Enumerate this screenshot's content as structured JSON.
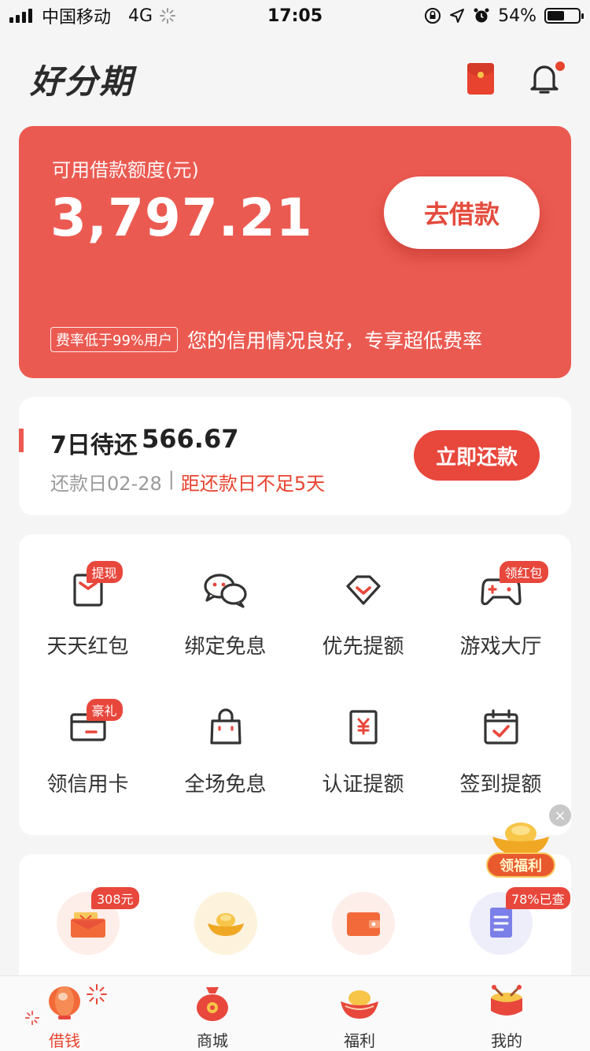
{
  "status_bar": {
    "carrier": "中国移动",
    "network": "4G",
    "time": "17:05",
    "battery": "54%",
    "battery_level": 0.54
  },
  "header": {
    "logo": "好分期",
    "icons": [
      "red-envelope-icon",
      "bell-icon"
    ]
  },
  "credit": {
    "label": "可用借款额度(元)",
    "amount": "3,797.21",
    "borrow_button": "去借款",
    "tag": "费率低于99%用户",
    "note": "您的信用情况良好，专享超低费率"
  },
  "repay": {
    "title": "7日待还",
    "amount": "566.67",
    "due_date": "还款日02-28",
    "separator": "|",
    "warning": "距还款日不足5天",
    "button": "立即还款"
  },
  "grid": [
    {
      "label": "天天红包",
      "badge": "提现",
      "icon": "red-envelope-icon"
    },
    {
      "label": "绑定免息",
      "badge": "",
      "icon": "wechat-icon"
    },
    {
      "label": "优先提额",
      "badge": "",
      "icon": "diamond-icon"
    },
    {
      "label": "游戏大厅",
      "badge": "领红包",
      "icon": "gamepad-icon"
    },
    {
      "label": "领信用卡",
      "badge": "豪礼",
      "icon": "credit-card-icon"
    },
    {
      "label": "全场免息",
      "badge": "",
      "icon": "shopping-bag-icon"
    },
    {
      "label": "认证提额",
      "badge": "",
      "icon": "certificate-icon"
    },
    {
      "label": "签到提额",
      "badge": "",
      "icon": "calendar-check-icon"
    }
  ],
  "services": [
    {
      "badge": "308元",
      "icon": "red-envelope-icon"
    },
    {
      "badge": "",
      "icon": "gold-ingot-icon"
    },
    {
      "badge": "",
      "icon": "wallet-icon"
    },
    {
      "badge": "78%已查",
      "icon": "document-icon"
    }
  ],
  "floating": {
    "label": "领福利",
    "close": "×"
  },
  "tabbar": [
    {
      "label": "借钱",
      "active": true,
      "icon": "lantern-icon"
    },
    {
      "label": "商城",
      "active": false,
      "icon": "lucky-bag-icon"
    },
    {
      "label": "福利",
      "active": false,
      "icon": "gold-ingot-icon"
    },
    {
      "label": "我的",
      "active": false,
      "icon": "drum-icon"
    }
  ],
  "colors": {
    "accent": "#eb5a51",
    "button_red": "#e8473c",
    "gold": "#f6c44b"
  }
}
